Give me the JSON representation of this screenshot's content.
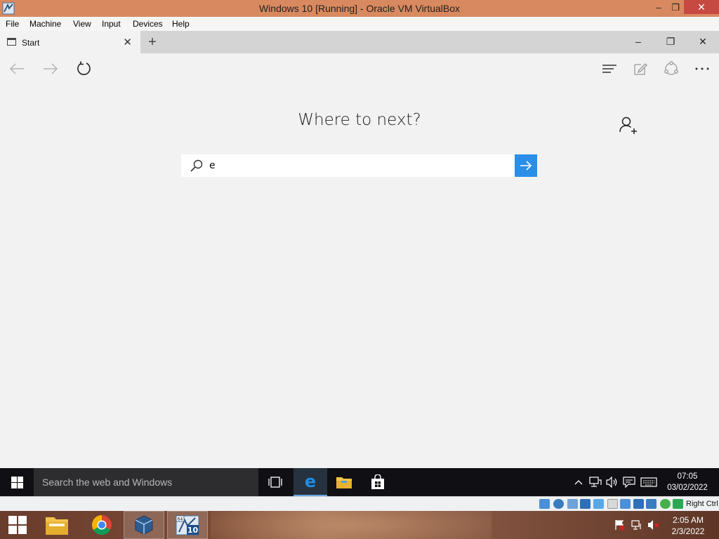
{
  "vbox": {
    "window_title": "Windows 10  [Running] - Oracle VM VirtualBox",
    "menu": [
      "File",
      "Machine",
      "View",
      "Input",
      "Devices",
      "Help"
    ],
    "host_key": "Right Ctrl"
  },
  "edge": {
    "tab": {
      "label": "Start"
    },
    "nav": {
      "back": "back-icon",
      "forward": "forward-icon",
      "refresh": "refresh-icon"
    },
    "toolbar_icons": [
      "hub-icon",
      "web-note-icon",
      "share-icon",
      "more-icon"
    ]
  },
  "start_page": {
    "heading": "Where to next?",
    "search": {
      "value": "e"
    },
    "accent": "#2b8fe8"
  },
  "guest_taskbar": {
    "search_placeholder": "Search the web and Windows",
    "clock": {
      "time": "07:05",
      "date": "03/02/2022"
    }
  },
  "host_taskbar": {
    "clock": {
      "time": "2:05 AM",
      "date": "2/3/2022"
    },
    "vbox_badge": {
      "bits": "64",
      "version": "10"
    }
  }
}
